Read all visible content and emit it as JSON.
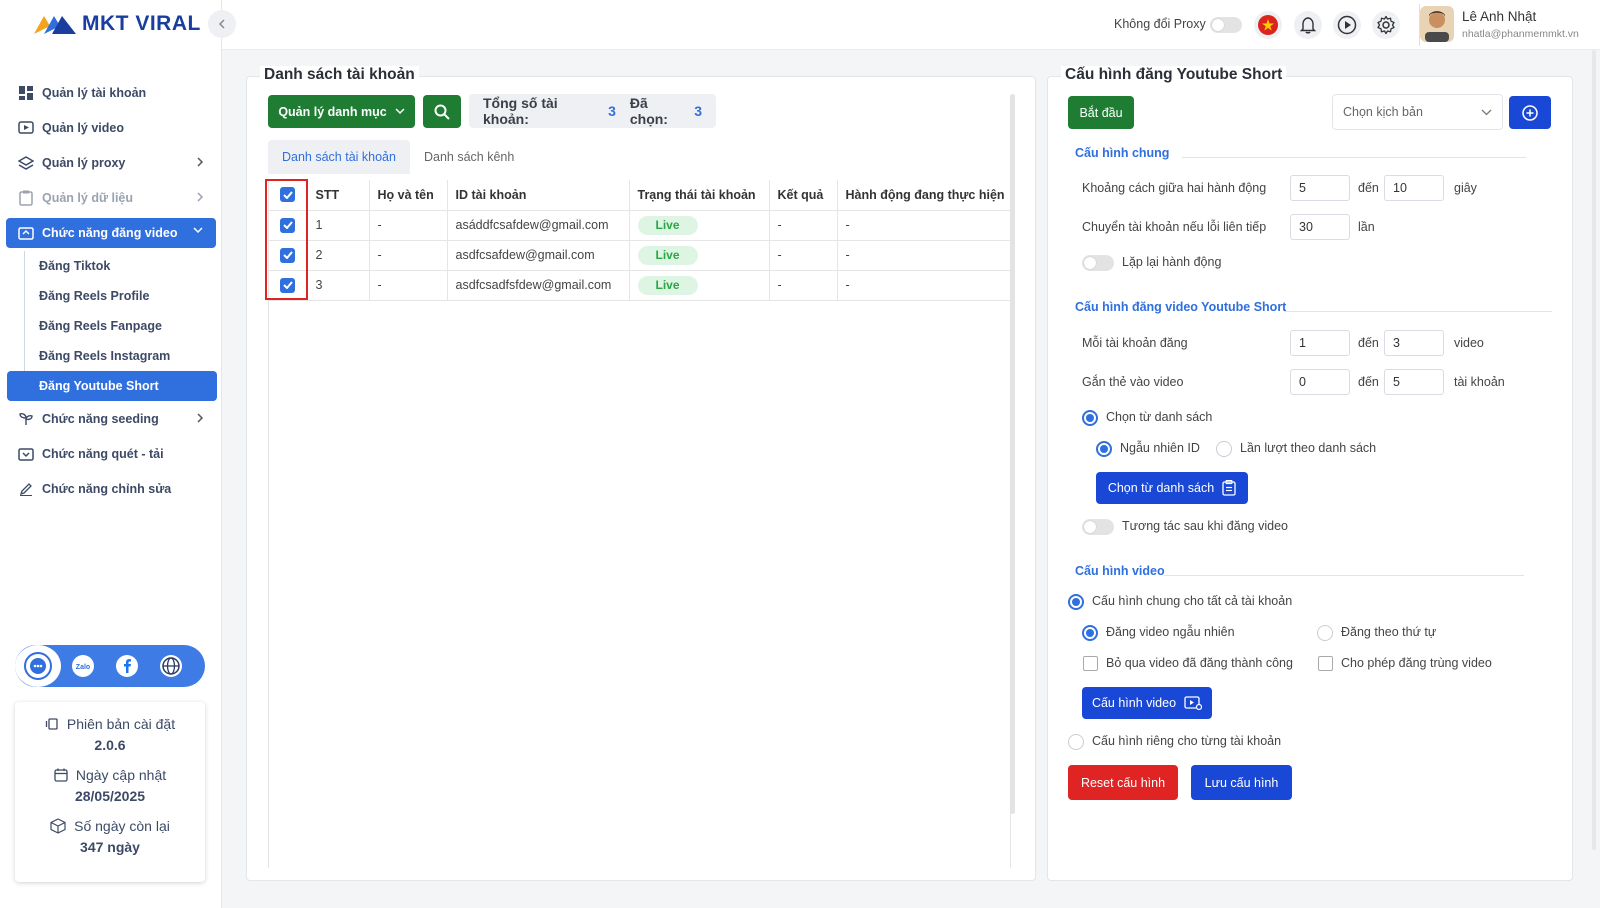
{
  "app": {
    "logo_text": "MKT VIRAL"
  },
  "sidebar": {
    "items": [
      {
        "label": "Quản lý tài khoản",
        "icon": "dashboard-icon"
      },
      {
        "label": "Quản lý video",
        "icon": "video-icon"
      },
      {
        "label": "Quản lý proxy",
        "icon": "layers-icon"
      },
      {
        "label": "Quản lý dữ liệu",
        "icon": "clipboard-icon"
      },
      {
        "label": "Chức năng đăng video",
        "icon": "upload-icon"
      },
      {
        "label": "Chức năng seeding",
        "icon": "seedling-icon"
      },
      {
        "label": "Chức năng quét - tải",
        "icon": "download-icon"
      },
      {
        "label": "Chức năng chỉnh sửa",
        "icon": "pencil-icon"
      }
    ],
    "subitems": [
      "Đăng Tiktok",
      "Đăng Reels Profile",
      "Đăng Reels Fanpage",
      "Đăng Reels Instagram",
      "Đăng Youtube Short"
    ]
  },
  "info": {
    "version_label": "Phiên bản cài đặt",
    "version": "2.0.6",
    "update_label": "Ngày cập nhật",
    "update_date": "28/05/2025",
    "remaining_label": "Số ngày còn lại",
    "remaining": "347 ngày"
  },
  "topbar": {
    "proxy_label": "Không đổi Proxy",
    "user_name": "Lê Anh Nhật",
    "user_email": "nhatla@phanmemmkt.vn"
  },
  "accounts": {
    "title": "Danh sách tài khoản",
    "manage_btn": "Quản lý danh mục",
    "total_label": "Tổng số tài khoản:",
    "total": "3",
    "selected_label": "Đã chọn:",
    "selected": "3",
    "tabs": [
      "Danh sách tài khoản",
      "Danh sách kênh"
    ],
    "columns": [
      "STT",
      "Họ và tên",
      "ID tài khoản",
      "Trạng thái tài khoản",
      "Kết quả",
      "Hành động đang thực hiện"
    ],
    "rows": [
      {
        "stt": "1",
        "name": "-",
        "id": "asáddfcsafdew@gmail.com",
        "status": "Live",
        "result": "-",
        "action": "-"
      },
      {
        "stt": "2",
        "name": "-",
        "id": "asdfcsafdew@gmail.com",
        "status": "Live",
        "result": "-",
        "action": "-"
      },
      {
        "stt": "3",
        "name": "-",
        "id": "asdfcsadfsfdew@gmail.com",
        "status": "Live",
        "result": "-",
        "action": "-"
      }
    ]
  },
  "config": {
    "title": "Cấu hình đăng Youtube Short",
    "start_btn": "Bắt đầu",
    "script_placeholder": "Chọn kịch bản",
    "general": {
      "title": "Cấu hình chung",
      "interval_label": "Khoảng cách giữa hai hành động",
      "interval_from": "5",
      "to_word": "đến",
      "interval_to": "10",
      "seconds": "giây",
      "switch_label": "Chuyển tài khoản nếu lỗi liên tiếp",
      "switch_value": "30",
      "times": "lần",
      "repeat_label": "Lặp lại hành động"
    },
    "upload": {
      "title": "Cấu hình đăng video Youtube Short",
      "per_account_label": "Mỗi tài khoản đăng",
      "per_from": "1",
      "per_to": "3",
      "video_unit": "video",
      "tag_label": "Gắn thẻ vào video",
      "tag_from": "0",
      "tag_to": "5",
      "account_unit": "tài khoản",
      "choose_list": "Chọn từ danh sách",
      "random_id": "Ngẫu nhiên ID",
      "sequential": "Lần lượt theo danh sách",
      "choose_btn": "Chọn từ danh sách",
      "interact_label": "Tương tác sau khi đăng video"
    },
    "video": {
      "title": "Cấu hình video",
      "common_all": "Cấu hình chung cho tất cả tài khoản",
      "random_post": "Đăng video ngẫu nhiên",
      "order_post": "Đăng theo thứ tự",
      "skip_posted": "Bỏ qua video đã đăng thành công",
      "allow_duplicate": "Cho phép đăng trùng video",
      "config_btn": "Cấu hình video",
      "per_account": "Cấu hình riêng cho từng tài khoản"
    },
    "reset_btn": "Reset cấu hình",
    "save_btn": "Lưu cấu hình"
  }
}
